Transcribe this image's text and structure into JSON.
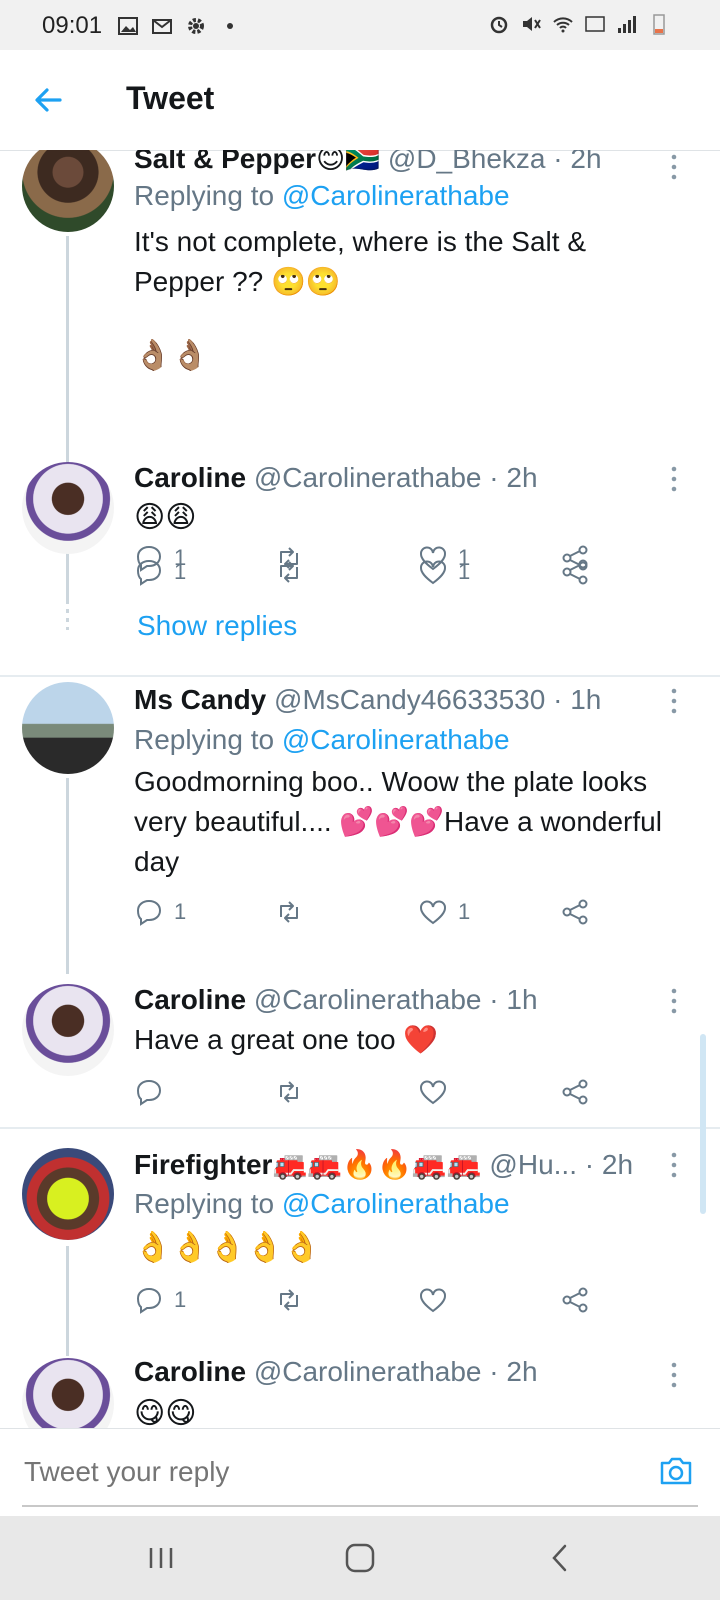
{
  "status_bar": {
    "time": "09:01"
  },
  "header": {
    "title": "Tweet"
  },
  "tweets": [
    {
      "name": "Salt & Pepper😊🇿🇦",
      "handle": "@D_Bhekza",
      "time": "2h",
      "replying_label": "Replying to",
      "replying_handle": "@Carolinerathabe",
      "text": "It's not complete, where is the Salt & Pepper ?? 🙄🙄",
      "emoji_line": "👌🏽👌🏽",
      "reply_count": "1",
      "like_count": "1"
    },
    {
      "name": "Caroline",
      "handle": "@Carolinerathabe",
      "time": "2h",
      "text": "😩😩",
      "reply_count": "1",
      "like_count": "1",
      "show_replies": "Show replies"
    },
    {
      "name": "Ms Candy",
      "handle": "@MsCandy46633530",
      "time": "1h",
      "replying_label": "Replying to",
      "replying_handle": "@Carolinerathabe",
      "text": "Goodmorning boo.. Woow the plate looks very beautiful.... 💕💕💕Have a wonderful day",
      "reply_count": "1",
      "like_count": "1"
    },
    {
      "name": "Caroline",
      "handle": "@Carolinerathabe",
      "time": "1h",
      "text": "Have a great one too ❤️",
      "reply_count": "",
      "like_count": ""
    },
    {
      "name": "Firefighter🚒🚒🔥🔥🚒🚒",
      "handle": "@Hu...",
      "time": "2h",
      "replying_label": "Replying to",
      "replying_handle": "@Carolinerathabe",
      "text": "👌👌👌👌👌",
      "reply_count": "1",
      "like_count": ""
    },
    {
      "name": "Caroline",
      "handle": "@Carolinerathabe",
      "time": "2h",
      "text": "😋😋"
    }
  ],
  "reply_bar": {
    "placeholder": "Tweet your reply"
  },
  "icons": {
    "reply": "reply-icon",
    "retweet": "retweet-icon",
    "like": "heart-icon",
    "share": "share-icon",
    "back": "back-arrow-icon",
    "camera": "camera-icon"
  },
  "colors": {
    "accent": "#1da1f2",
    "text": "#14171a",
    "muted": "#657786",
    "divider": "#e6ecf0"
  }
}
